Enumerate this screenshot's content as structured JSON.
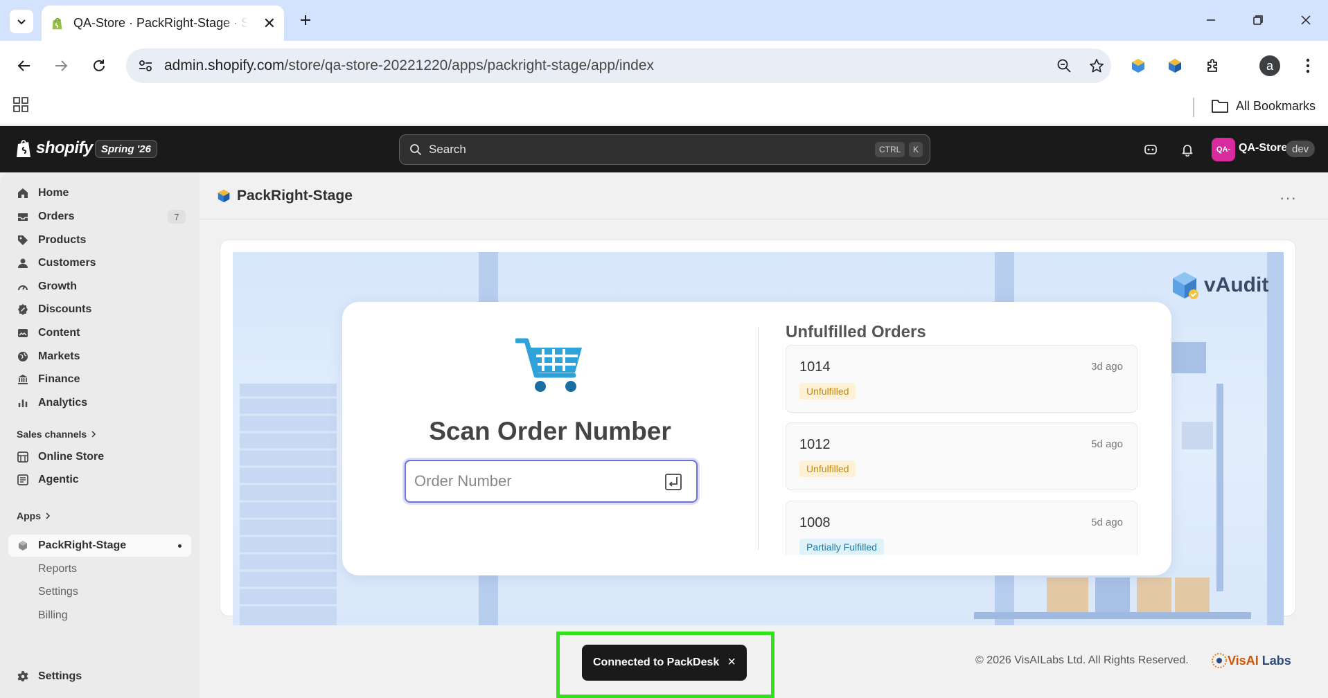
{
  "browser": {
    "tab_title": "QA-Store · PackRight-Stage · Shopify",
    "url_domain": "admin.shopify.com",
    "url_path": "/store/qa-store-20221220/apps/packright-stage/app/index",
    "profile_initial": "a",
    "bookmarks_label": "All Bookmarks"
  },
  "shopify": {
    "wordmark": "shopify",
    "edition_badge": "Spring '26",
    "search_placeholder": "Search",
    "shortcut_key1": "CTRL",
    "shortcut_key2": "K",
    "store_avatar": "QA-",
    "store_name": "QA-Store",
    "store_badge": "dev"
  },
  "sidebar": {
    "items": [
      {
        "label": "Home",
        "icon": "home-icon"
      },
      {
        "label": "Orders",
        "icon": "inbox-icon",
        "count": "7"
      },
      {
        "label": "Products",
        "icon": "tag-icon"
      },
      {
        "label": "Customers",
        "icon": "person-icon"
      },
      {
        "label": "Growth",
        "icon": "gauge-icon"
      },
      {
        "label": "Discounts",
        "icon": "discount-icon"
      },
      {
        "label": "Content",
        "icon": "image-icon"
      },
      {
        "label": "Markets",
        "icon": "globe-icon"
      },
      {
        "label": "Finance",
        "icon": "bank-icon"
      },
      {
        "label": "Analytics",
        "icon": "bar-chart-icon"
      }
    ],
    "sales_channels_heading": "Sales channels",
    "channels": [
      {
        "label": "Online Store",
        "icon": "store-icon"
      },
      {
        "label": "Agentic",
        "icon": "agentic-icon"
      }
    ],
    "apps_heading": "Apps",
    "active_app": "PackRight-Stage",
    "app_subitems": [
      "Reports",
      "Settings",
      "Billing"
    ],
    "settings_label": "Settings"
  },
  "app": {
    "title": "PackRight-Stage",
    "more_label": "···",
    "scan_title": "Scan Order Number",
    "order_placeholder": "Order Number",
    "unfulfilled_title": "Unfulfilled Orders",
    "orders": [
      {
        "number": "1014",
        "time": "3d ago",
        "status": "Unfulfilled",
        "kind": "unf"
      },
      {
        "number": "1012",
        "time": "5d ago",
        "status": "Unfulfilled",
        "kind": "unf"
      },
      {
        "number": "1008",
        "time": "5d ago",
        "status": "Partially Fulfilled",
        "kind": "part"
      }
    ],
    "brand_logo_text": "vAudit",
    "footer_copyright": "© 2026 VisAILabs Ltd. All Rights Reserved.",
    "footer_brand_a": "VisAI",
    "footer_brand_b": "Labs"
  },
  "toast": {
    "message": "Connected to PackDesk",
    "close": "×"
  },
  "colors": {
    "shopify_dark": "#1a1a1a",
    "toast_highlight": "#33e01c",
    "input_focus": "#6b6fd6",
    "cart_blue": "#2fa3d9"
  }
}
